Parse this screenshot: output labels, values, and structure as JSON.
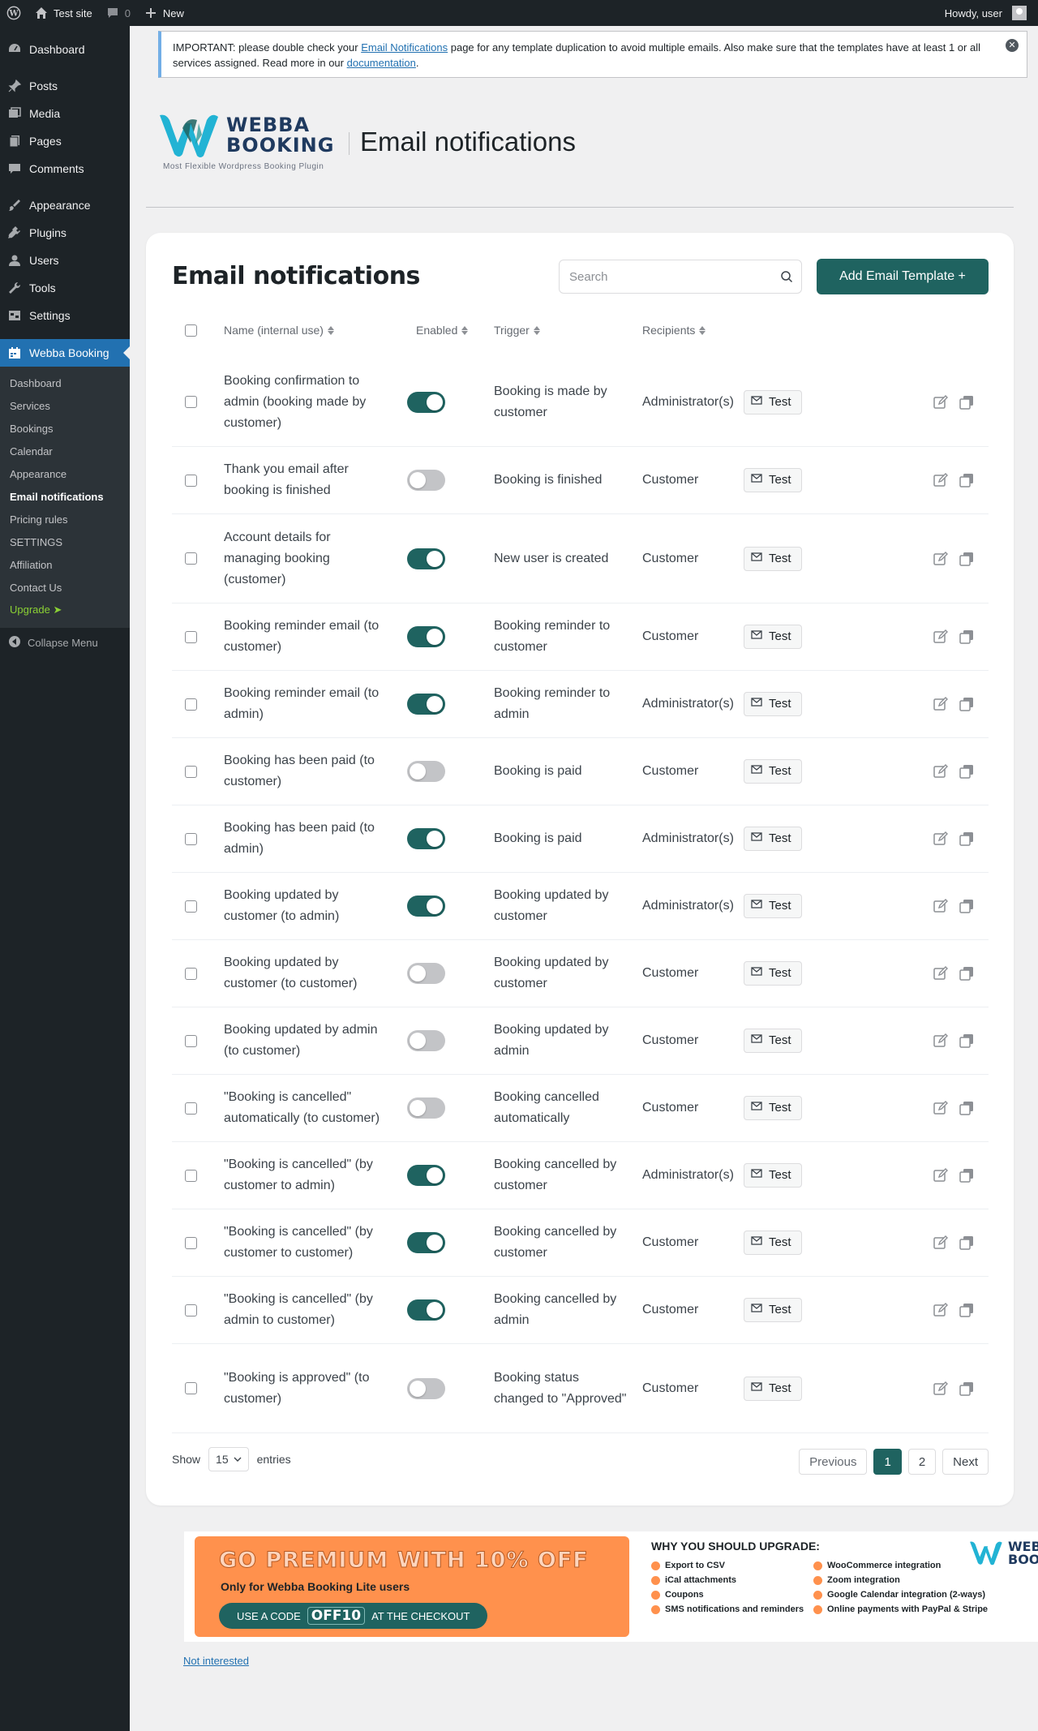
{
  "adminbar": {
    "site_name": "Test site",
    "comments_count": "0",
    "new_label": "New",
    "howdy": "Howdy, user"
  },
  "sidebar": {
    "items": [
      {
        "label": "Dashboard",
        "icon": "dashboard-icon"
      },
      {
        "label": "Posts",
        "icon": "pin-icon"
      },
      {
        "label": "Media",
        "icon": "media-icon"
      },
      {
        "label": "Pages",
        "icon": "pages-icon"
      },
      {
        "label": "Comments",
        "icon": "comment-icon"
      },
      {
        "label": "Appearance",
        "icon": "brush-icon"
      },
      {
        "label": "Plugins",
        "icon": "plug-icon"
      },
      {
        "label": "Users",
        "icon": "user-icon"
      },
      {
        "label": "Tools",
        "icon": "wrench-icon"
      },
      {
        "label": "Settings",
        "icon": "settings-icon"
      },
      {
        "label": "Webba Booking",
        "icon": "calendar-icon"
      }
    ],
    "submenu": [
      "Dashboard",
      "Services",
      "Bookings",
      "Calendar",
      "Appearance",
      "Email notifications",
      "Pricing rules",
      "SETTINGS",
      "Affiliation",
      "Contact Us",
      "Upgrade ➤"
    ],
    "collapse_label": "Collapse Menu"
  },
  "notice": {
    "text_1": "IMPORTANT: please double check your ",
    "link_1": "Email Notifications",
    "text_2": " page for any template duplication to avoid multiple emails. Also make sure that the templates have at least 1 or all services assigned. Read more in our ",
    "link_2": "documentation",
    "text_3": "."
  },
  "brand": {
    "line1": "WEBBA",
    "line2": "BOOKING",
    "tagline": "Most Flexible Wordpress Booking Plugin"
  },
  "page_title": "Email notifications",
  "card": {
    "title": "Email notifications",
    "search_placeholder": "Search",
    "add_button": "Add Email Template +",
    "columns": {
      "name": "Name (internal use)",
      "enabled": "Enabled",
      "trigger": "Trigger",
      "recipients": "Recipients"
    },
    "test_label": "Test",
    "rows": [
      {
        "name": "Booking confirmation to admin (booking made by customer)",
        "enabled": true,
        "trigger": "Booking is made by customer",
        "recipients": "Administrator(s)"
      },
      {
        "name": "Thank you email after booking is finished",
        "enabled": false,
        "trigger": "Booking is finished",
        "recipients": "Customer"
      },
      {
        "name": "Account details for managing booking (customer)",
        "enabled": true,
        "trigger": "New user is created",
        "recipients": "Customer"
      },
      {
        "name": "Booking reminder email (to customer)",
        "enabled": true,
        "trigger": "Booking reminder to customer",
        "recipients": "Customer"
      },
      {
        "name": "Booking reminder email (to admin)",
        "enabled": true,
        "trigger": "Booking reminder to admin",
        "recipients": "Administrator(s)"
      },
      {
        "name": "Booking has been paid (to customer)",
        "enabled": false,
        "trigger": "Booking is paid",
        "recipients": "Customer"
      },
      {
        "name": "Booking has been paid (to admin)",
        "enabled": true,
        "trigger": "Booking is paid",
        "recipients": "Administrator(s)"
      },
      {
        "name": "Booking updated by customer (to admin)",
        "enabled": true,
        "trigger": "Booking updated by customer",
        "recipients": "Administrator(s)"
      },
      {
        "name": "Booking updated by customer (to customer)",
        "enabled": false,
        "trigger": "Booking updated by customer",
        "recipients": "Customer"
      },
      {
        "name": "Booking updated by admin (to customer)",
        "enabled": false,
        "trigger": "Booking updated by admin",
        "recipients": "Customer"
      },
      {
        "name": "\"Booking is cancelled\" automatically (to customer)",
        "enabled": false,
        "trigger": "Booking cancelled automatically",
        "recipients": "Customer"
      },
      {
        "name": "\"Booking is cancelled\" (by customer to admin)",
        "enabled": true,
        "trigger": "Booking cancelled by customer",
        "recipients": "Administrator(s)"
      },
      {
        "name": "\"Booking is cancelled\" (by customer to customer)",
        "enabled": true,
        "trigger": "Booking cancelled by customer",
        "recipients": "Customer"
      },
      {
        "name": "\"Booking is cancelled\" (by admin to customer)",
        "enabled": true,
        "trigger": "Booking cancelled by admin",
        "recipients": "Customer"
      },
      {
        "name": "\"Booking is approved\" (to customer)",
        "enabled": false,
        "trigger": "Booking status changed to \"Approved\"",
        "recipients": "Customer"
      }
    ],
    "show_label": "Show",
    "entries_value": "15",
    "entries_label": "entries",
    "pagination": {
      "previous": "Previous",
      "pages": [
        "1",
        "2"
      ],
      "current": "1",
      "next": "Next"
    }
  },
  "promo": {
    "headline": "GO PREMIUM WITH 10% OFF",
    "subline": "Only for Webba Booking Lite users",
    "code_prefix": "USE A CODE",
    "code": "OFF10",
    "code_suffix": "AT THE CHECKOUT",
    "why_title": "WHY YOU SHOULD UPGRADE:",
    "features": [
      "Export to CSV",
      "WooCommerce integration",
      "iCal attachments",
      "Zoom integration",
      "Coupons",
      "Google Calendar integration (2-ways)",
      "SMS notifications and reminders",
      "Online payments with PayPal & Stripe"
    ],
    "logo_line1": "WEB",
    "logo_line2": "BOO",
    "colors": {
      "orange": "#ff914d",
      "teal": "#1f6360"
    }
  },
  "not_interested": "Not interested",
  "colors": {
    "accent": "#1f6360",
    "wp_blue": "#2271b1",
    "admin_dark": "#1d2327"
  }
}
